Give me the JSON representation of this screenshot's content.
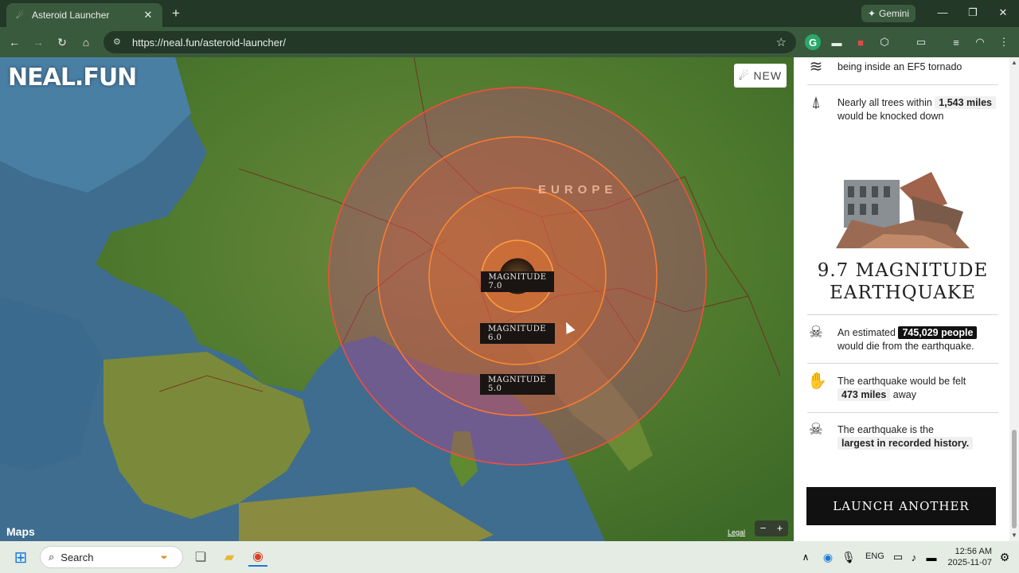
{
  "browser": {
    "tab_title": "Asteroid Launcher",
    "tab_icon": "comet-icon",
    "url": "https://neal.fun/asteroid-launcher/",
    "gemini_label": "Gemini",
    "colors": {
      "frame": "#233826",
      "toolbar": "#3a5a3e"
    }
  },
  "map": {
    "logo": "NEAL.FUN",
    "new_badge": "NEW",
    "region_label": "EUROPE",
    "rings": [
      {
        "label": "MAGNITUDE 7.0"
      },
      {
        "label": "MAGNITUDE 6.0"
      },
      {
        "label": "MAGNITUDE 5.0"
      }
    ],
    "attribution": "Maps",
    "legal": "Legal",
    "zoom_out": "−",
    "zoom_in": "+"
  },
  "panel": {
    "fact_top": "being inside an EF5 tornado",
    "trees": {
      "before": "Nearly all trees within",
      "value": "1,543 miles",
      "after": "would be knocked down"
    },
    "quake_title_line1": "9.7 MAGNITUDE",
    "quake_title_line2": "EARTHQUAKE",
    "deaths": {
      "before": "An estimated",
      "value": "745,029 people",
      "after": "would die from the earthquake."
    },
    "felt": {
      "before": "The earthquake would be felt",
      "value": "473 miles",
      "after": "away"
    },
    "record": {
      "before": "The earthquake is the",
      "value": "largest in recorded history."
    },
    "launch_button": "LAUNCH ANOTHER"
  },
  "taskbar": {
    "search_placeholder": "Search",
    "language": "ENG",
    "time": "12:56 AM",
    "date": "2025-11-07"
  }
}
